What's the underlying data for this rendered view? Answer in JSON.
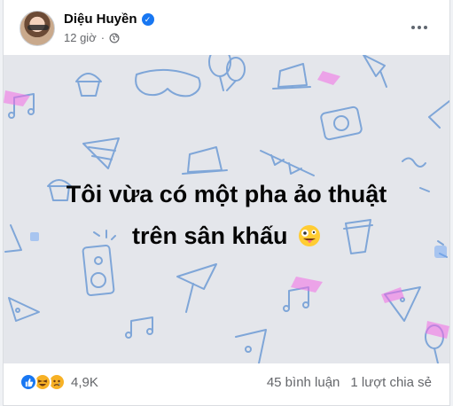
{
  "post": {
    "author": "Diệu Huyền",
    "time": "12 giờ",
    "separator": "·",
    "text_line1": "Tôi vừa có một pha ảo thuật",
    "text_line2": "trên sân khấu",
    "background_color": "#e4e6eb",
    "pattern_color": "#7fa6d8",
    "accent_pink": "#f36be6"
  },
  "icons": {
    "verified": "verified-badge-icon",
    "privacy": "globe-icon",
    "more": "more-options-icon",
    "emoji": "zany-face-emoji",
    "reactions": [
      "like-reaction-icon",
      "haha-reaction-icon",
      "sad-reaction-icon"
    ]
  },
  "footer": {
    "reaction_count": "4,9K",
    "comments": "45 bình luận",
    "shares": "1 lượt chia sẻ"
  }
}
